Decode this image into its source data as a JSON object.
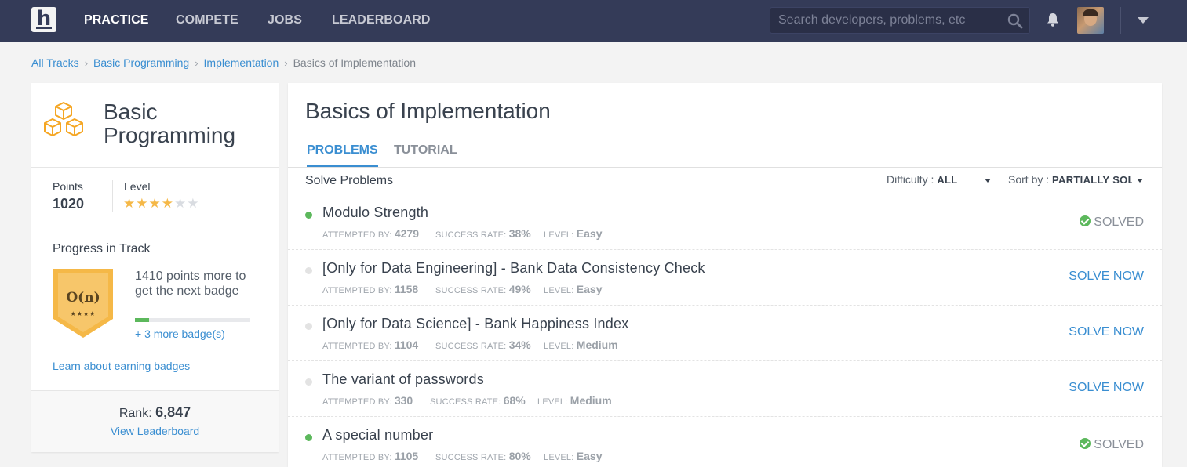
{
  "nav": {
    "links": [
      "PRACTICE",
      "COMPETE",
      "JOBS",
      "LEADERBOARD"
    ],
    "active": "PRACTICE",
    "search_placeholder": "Search developers, problems, etc",
    "logo_letter": "h"
  },
  "breadcrumb": {
    "items": [
      "All Tracks",
      "Basic Programming",
      "Implementation"
    ],
    "current": "Basics of Implementation",
    "separator": "›"
  },
  "track": {
    "title": "Basic Programming",
    "points_label": "Points",
    "points_value": "1020",
    "level_label": "Level",
    "level_stars_filled": 4,
    "level_stars_total": 6,
    "progress_title": "Progress in Track",
    "badge_symbol": "O(n)",
    "badge_stars": "★★★★",
    "badge_text": "1410 points more to get the next badge",
    "progress_fraction": 0.12,
    "more_badges": "+ 3 more badge(s)",
    "learn_link": "Learn about earning badges",
    "rank_label": "Rank:",
    "rank_value": "6,847",
    "leaderboard_link": "View Leaderboard"
  },
  "main": {
    "title": "Basics of Implementation",
    "tabs": [
      "PROBLEMS",
      "TUTORIAL"
    ],
    "active_tab": "PROBLEMS",
    "solve_label": "Solve Problems",
    "difficulty_label": "Difficulty :",
    "difficulty_value": "ALL",
    "sort_label": "Sort by :",
    "sort_value": "PARTIALLY SOLVED",
    "meta_labels": {
      "attempted": "ATTEMPTED BY:",
      "success": "SUCCESS RATE:",
      "level": "LEVEL:"
    },
    "problems": [
      {
        "name": "Modulo Strength",
        "attempted": "4279",
        "success": "38%",
        "level": "Easy",
        "status": "SOLVED",
        "solved": true
      },
      {
        "name": "[Only for Data Engineering] - Bank Data Consistency Check",
        "attempted": "1158",
        "success": "49%",
        "level": "Easy",
        "status": "SOLVE NOW",
        "solved": false
      },
      {
        "name": "[Only for Data Science] - Bank Happiness Index",
        "attempted": "1104",
        "success": "34%",
        "level": "Medium",
        "status": "SOLVE NOW",
        "solved": false
      },
      {
        "name": "The variant of passwords",
        "attempted": "330",
        "success": "68%",
        "level": "Medium",
        "status": "SOLVE NOW",
        "solved": false
      },
      {
        "name": "A special number",
        "attempted": "1105",
        "success": "80%",
        "level": "Easy",
        "status": "SOLVED",
        "solved": true
      }
    ]
  },
  "colors": {
    "navbar": "#343b58",
    "accent_blue": "#3a8ed1",
    "solved_green": "#5cb85c",
    "star_gold": "#f5b847"
  },
  "icons": [
    "hackerearth-logo-icon",
    "search-icon",
    "bell-icon",
    "avatar",
    "chevron-down-icon",
    "cubes-icon",
    "badge-icon",
    "check-circle-icon"
  ]
}
